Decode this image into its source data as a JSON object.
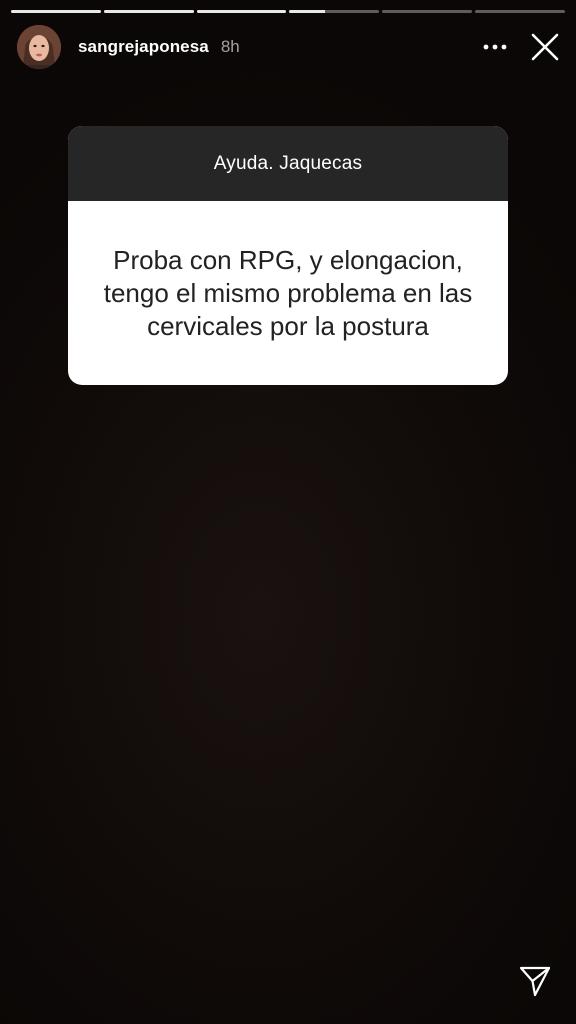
{
  "story": {
    "progress": {
      "segments": [
        1,
        1,
        1,
        0.4,
        0,
        0
      ]
    },
    "header": {
      "username": "sangrejaponesa",
      "timestamp": "8h",
      "icons": {
        "avatar": "profile-avatar",
        "more": "more-options-icon",
        "close": "close-icon"
      }
    },
    "question_sticker": {
      "question": "Ayuda. Jaquecas",
      "answer": "Proba con RPG, y elongacion, tengo el mismo problema en las cervicales por la postura"
    },
    "footer": {
      "icons": {
        "send": "send-icon"
      }
    },
    "colors": {
      "background": "#0c0807",
      "card_header": "#262626",
      "card_body": "#ffffff",
      "text_light": "#ffffff",
      "text_dark": "#222222"
    }
  }
}
